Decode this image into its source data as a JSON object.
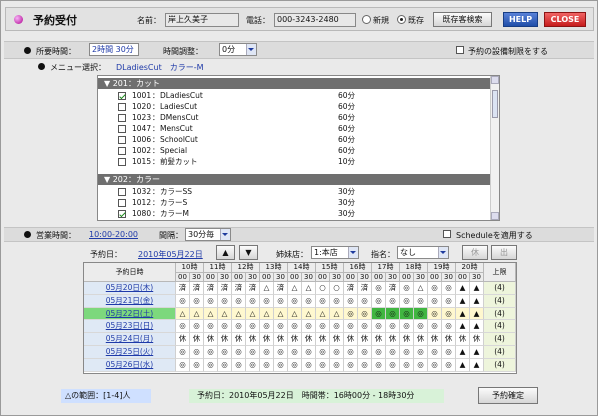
{
  "header": {
    "title": "予約受付",
    "name_label": "名前：",
    "name_value": "岸上久美子",
    "phone_label": "電話：",
    "phone_value": "000-3243-2480",
    "radio_new": "新規",
    "radio_existing": "既存",
    "search_button": "既存客検索",
    "help_button": "HELP",
    "close_button": "CLOSE"
  },
  "duration": {
    "label": "所要時間：",
    "value": "2時間 30分",
    "adjust_label": "時間調整：",
    "adjust_value": "0分",
    "restrict_label": "予約の設備制限をする"
  },
  "menu": {
    "label": "メニュー選択：",
    "selected": "DLadiesCut　カラー-M",
    "categories": [
      {
        "name": "201：カット",
        "items": [
          {
            "code": "1001",
            "name": "DLadiesCut",
            "time": "60分",
            "checked": true
          },
          {
            "code": "1020",
            "name": "LadiesCut",
            "time": "60分",
            "checked": false
          },
          {
            "code": "1023",
            "name": "DMensCut",
            "time": "60分",
            "checked": false
          },
          {
            "code": "1047",
            "name": "MensCut",
            "time": "60分",
            "checked": false
          },
          {
            "code": "1006",
            "name": "SchoolCut",
            "time": "60分",
            "checked": false
          },
          {
            "code": "1002",
            "name": "Special",
            "time": "60分",
            "checked": false
          },
          {
            "code": "1015",
            "name": "前髪カット",
            "time": "10分",
            "checked": false
          }
        ]
      },
      {
        "name": "202：カラー",
        "items": [
          {
            "code": "1032",
            "name": "カラーSS",
            "time": "30分",
            "checked": false
          },
          {
            "code": "1012",
            "name": "カラーS",
            "time": "30分",
            "checked": false
          },
          {
            "code": "1080",
            "name": "カラーM",
            "time": "30分",
            "checked": true
          },
          {
            "code": "1082",
            "name": "カラーL",
            "time": "30分",
            "checked": false
          }
        ]
      }
    ]
  },
  "business": {
    "label": "営業時間：",
    "value": "10:00-20:00",
    "interval_label": "間隔：",
    "interval_value": "30分毎",
    "schedule_label": "Scheduleを適用する"
  },
  "reserve": {
    "date_label": "予約日：",
    "date_value": "2010年05月22日",
    "prev": "▲",
    "next": "▼",
    "store_label": "姉妹店：",
    "store_value": "1:本店",
    "staff_label": "指名：",
    "staff_value": "なし",
    "btn_a": "休",
    "btn_b": "出"
  },
  "schedule": {
    "col_date": "予約日時",
    "col_limit": "上限",
    "hours": [
      "10時",
      "11時",
      "12時",
      "13時",
      "14時",
      "15時",
      "16時",
      "17時",
      "18時",
      "19時",
      "20時"
    ],
    "mins": [
      "00",
      "30"
    ],
    "rows": [
      {
        "date": "05月20日(木)",
        "cells": [
          "済",
          "済",
          "済",
          "済",
          "済",
          "済",
          "△",
          "済",
          "△",
          "△",
          "○",
          "○",
          "済",
          "済",
          "◎",
          "済",
          "◎",
          "△",
          "◎",
          "◎",
          "▲",
          "▲"
        ],
        "limit": "(4)",
        "sel": false
      },
      {
        "date": "05月21日(金)",
        "cells": [
          "◎",
          "◎",
          "◎",
          "◎",
          "◎",
          "◎",
          "◎",
          "◎",
          "◎",
          "◎",
          "◎",
          "◎",
          "◎",
          "◎",
          "◎",
          "◎",
          "◎",
          "◎",
          "◎",
          "◎",
          "▲",
          "▲"
        ],
        "limit": "(4)",
        "sel": false
      },
      {
        "date": "05月22日(土)",
        "cells": [
          "△",
          "△",
          "△",
          "△",
          "△",
          "△",
          "△",
          "△",
          "△",
          "△",
          "△",
          "△",
          "◎",
          "◎",
          "◎",
          "◎",
          "◎",
          "◎",
          "◎",
          "◎",
          "▲",
          "▲"
        ],
        "limit": "(4)",
        "sel": true
      },
      {
        "date": "05月23日(日)",
        "cells": [
          "◎",
          "◎",
          "◎",
          "◎",
          "◎",
          "◎",
          "◎",
          "◎",
          "◎",
          "◎",
          "◎",
          "◎",
          "◎",
          "◎",
          "◎",
          "◎",
          "◎",
          "◎",
          "◎",
          "◎",
          "▲",
          "▲"
        ],
        "limit": "(4)",
        "sel": false
      },
      {
        "date": "05月24日(月)",
        "cells": [
          "休",
          "休",
          "休",
          "休",
          "休",
          "休",
          "休",
          "休",
          "休",
          "休",
          "休",
          "休",
          "休",
          "休",
          "休",
          "休",
          "休",
          "休",
          "休",
          "休",
          "休",
          "休"
        ],
        "limit": "(4)",
        "sel": false
      },
      {
        "date": "05月25日(火)",
        "cells": [
          "◎",
          "◎",
          "◎",
          "◎",
          "◎",
          "◎",
          "◎",
          "◎",
          "◎",
          "◎",
          "◎",
          "◎",
          "◎",
          "◎",
          "◎",
          "◎",
          "◎",
          "◎",
          "◎",
          "◎",
          "▲",
          "▲"
        ],
        "limit": "(4)",
        "sel": false
      },
      {
        "date": "05月26日(水)",
        "cells": [
          "◎",
          "◎",
          "◎",
          "◎",
          "◎",
          "◎",
          "◎",
          "◎",
          "◎",
          "◎",
          "◎",
          "◎",
          "◎",
          "◎",
          "◎",
          "◎",
          "◎",
          "◎",
          "◎",
          "◎",
          "▲",
          "▲"
        ],
        "limit": "(4)",
        "sel": false
      }
    ],
    "green_cells": [
      14,
      15,
      16,
      17
    ]
  },
  "footer": {
    "range": "△の範囲：[1-4]人",
    "summary": "予約日：2010年05月22日　時間帯：16時00分 - 18時30分",
    "confirm": "予約確定"
  }
}
